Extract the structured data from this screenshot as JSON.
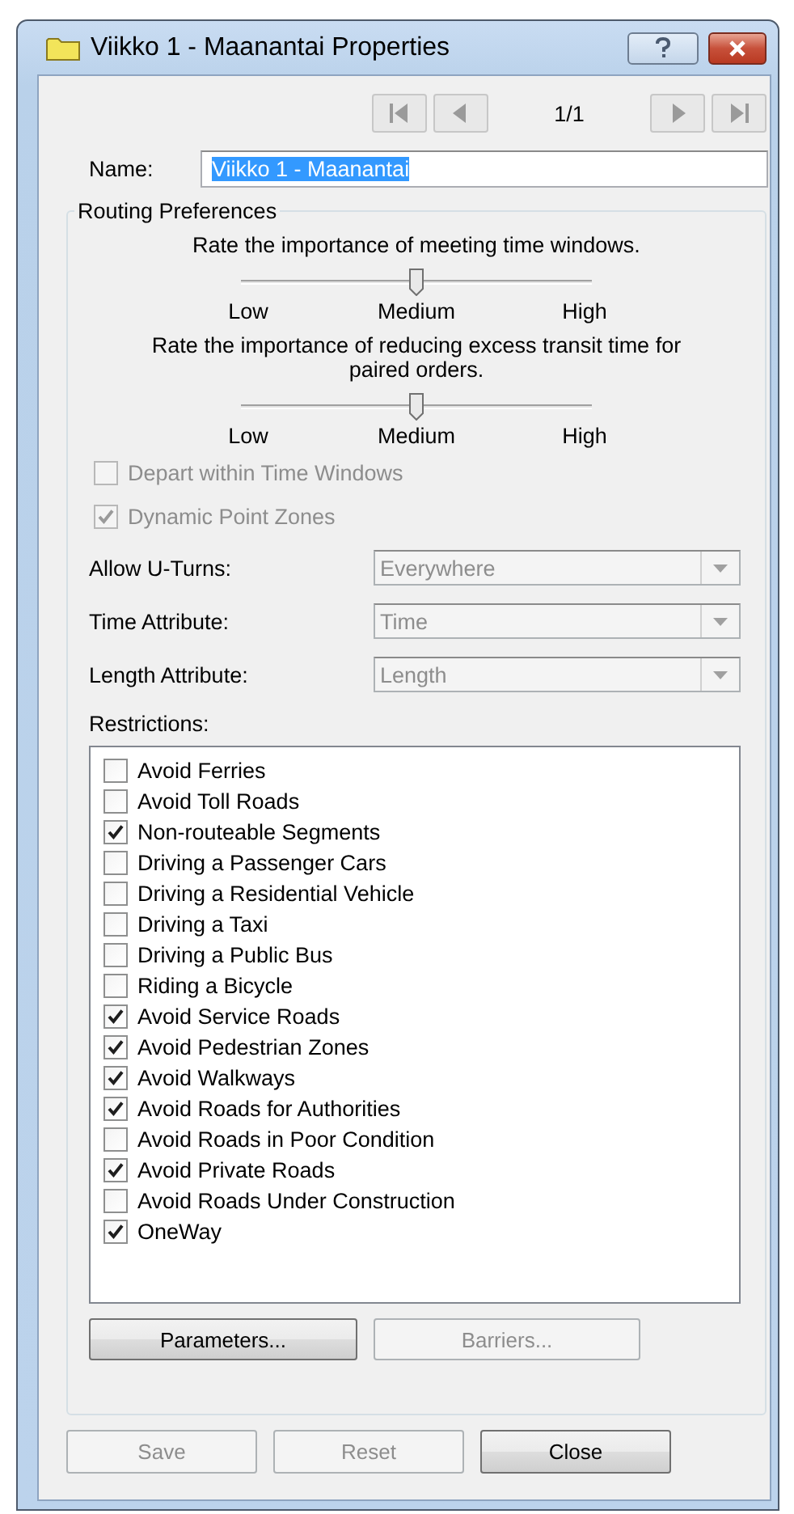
{
  "window": {
    "title": "Viikko 1 - Maanantai Properties"
  },
  "navigator": {
    "position": "1/1"
  },
  "name": {
    "label": "Name:",
    "value": "Viikko 1 - Maanantai",
    "text_selected": true
  },
  "routing_preferences": {
    "title": "Routing Preferences",
    "sliders": [
      {
        "prompt": "Rate the importance of meeting time windows.",
        "level": 0.5,
        "labels": [
          "Low",
          "Medium",
          "High"
        ]
      },
      {
        "prompt": "Rate the importance of reducing excess transit time for paired orders.",
        "level": 0.5,
        "labels": [
          "Low",
          "Medium",
          "High"
        ]
      }
    ],
    "options": [
      {
        "label": "Depart within Time Windows",
        "checked": false,
        "disabled": true
      },
      {
        "label": "Dynamic Point Zones",
        "checked": true,
        "disabled": true
      }
    ],
    "dropdowns": [
      {
        "label": "Allow U-Turns:",
        "value": "Everywhere",
        "disabled": true
      },
      {
        "label": "Time Attribute:",
        "value": "Time",
        "disabled": true
      },
      {
        "label": "Length Attribute:",
        "value": "Length",
        "disabled": true
      }
    ],
    "restrictions": {
      "label": "Restrictions:",
      "items": [
        {
          "label": "Avoid Ferries",
          "checked": false
        },
        {
          "label": "Avoid Toll Roads",
          "checked": false
        },
        {
          "label": "Non-routeable Segments",
          "checked": true
        },
        {
          "label": "Driving a Passenger Cars",
          "checked": false
        },
        {
          "label": "Driving a Residential Vehicle",
          "checked": false
        },
        {
          "label": "Driving a Taxi",
          "checked": false
        },
        {
          "label": "Driving a Public Bus",
          "checked": false
        },
        {
          "label": "Riding a Bicycle",
          "checked": false
        },
        {
          "label": "Avoid Service Roads",
          "checked": true
        },
        {
          "label": "Avoid Pedestrian Zones",
          "checked": true
        },
        {
          "label": "Avoid Walkways",
          "checked": true
        },
        {
          "label": "Avoid Roads for Authorities",
          "checked": true
        },
        {
          "label": "Avoid Roads in Poor Condition",
          "checked": false
        },
        {
          "label": "Avoid Private Roads",
          "checked": true
        },
        {
          "label": "Avoid Roads Under Construction",
          "checked": false
        },
        {
          "label": "OneWay",
          "checked": true
        }
      ]
    },
    "buttons": [
      {
        "label": "Parameters...",
        "disabled": false
      },
      {
        "label": "Barriers...",
        "disabled": true
      }
    ]
  },
  "footer_buttons": [
    {
      "label": "Save",
      "disabled": true
    },
    {
      "label": "Reset",
      "disabled": true
    },
    {
      "label": "Close",
      "disabled": false
    }
  ]
}
